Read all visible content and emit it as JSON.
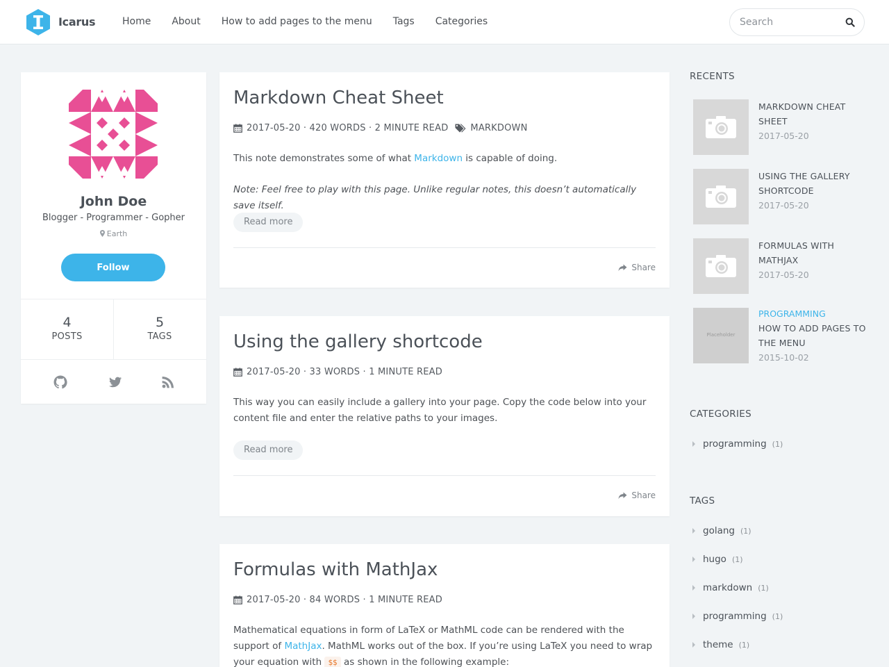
{
  "header": {
    "brand": "Icarus",
    "nav": [
      "Home",
      "About",
      "How to add pages to the menu",
      "Tags",
      "Categories"
    ],
    "search_placeholder": "Search"
  },
  "profile": {
    "name": "John Doe",
    "bio": "Blogger - Programmer - Gopher",
    "location": "Earth",
    "follow_label": "Follow",
    "posts_count": "4",
    "posts_label": "POSTS",
    "tags_count": "5",
    "tags_label": "TAGS",
    "socials": [
      "github-icon",
      "twitter-icon",
      "rss-icon"
    ]
  },
  "posts": [
    {
      "title": "Markdown Cheat Sheet",
      "meta": "2017-05-20 · 420 WORDS · 2 MINUTE READ",
      "tag": "MARKDOWN",
      "excerpt_pre": "This note demonstrates some of what ",
      "excerpt_link": "Markdown",
      "excerpt_post": " is capable of doing.",
      "note": "Note: Feel free to play with this page. Unlike regular notes, this doesn’t automatically save itself.",
      "read_more": "Read more",
      "share": "Share"
    },
    {
      "title": "Using the gallery shortcode",
      "meta": "2017-05-20 · 33 WORDS · 1 MINUTE READ",
      "excerpt": "This way you can easily include a gallery into your page. Copy the code below into your content file and enter the relative paths to your images.",
      "read_more": "Read more",
      "share": "Share"
    },
    {
      "title": "Formulas with MathJax",
      "meta": "2017-05-20 · 84 WORDS · 1 MINUTE READ",
      "excerpt_pre": "Mathematical equations in form of LaTeX or MathML code can be rendered with the support of ",
      "excerpt_link": "MathJax",
      "excerpt_mid": ". MathML works out of the box. If you’re using LaTeX you need to wrap your equation with ",
      "excerpt_code": "$$",
      "excerpt_post": " as shown in the following example:"
    }
  ],
  "sidebar": {
    "recents_heading": "RECENTS",
    "recents": [
      {
        "title": "MARKDOWN CHEAT SHEET",
        "date": "2017-05-20"
      },
      {
        "title": "USING THE GALLERY SHORTCODE",
        "date": "2017-05-20"
      },
      {
        "title": "FORMULAS WITH MATHJAX",
        "date": "2017-05-20"
      },
      {
        "category": "PROGRAMMING",
        "title": "HOW TO ADD PAGES TO THE MENU",
        "date": "2015-10-02",
        "thumb_label": "Placeholder"
      }
    ],
    "categories_heading": "CATEGORIES",
    "categories": [
      {
        "name": "programming",
        "count": "(1)"
      }
    ],
    "tags_heading": "TAGS",
    "tags": [
      {
        "name": "golang",
        "count": "(1)"
      },
      {
        "name": "hugo",
        "count": "(1)"
      },
      {
        "name": "markdown",
        "count": "(1)"
      },
      {
        "name": "programming",
        "count": "(1)"
      },
      {
        "name": "theme",
        "count": "(1)"
      }
    ]
  },
  "colors": {
    "accent": "#3db4e9",
    "avatar": "#e84f95",
    "background": "#f1f4f6"
  }
}
